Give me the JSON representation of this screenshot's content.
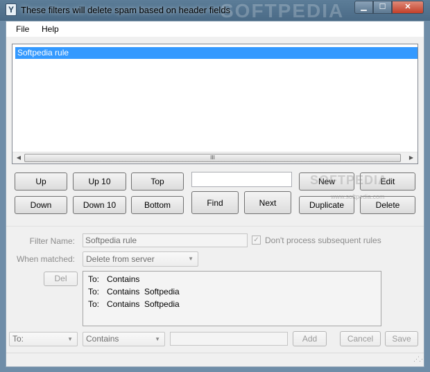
{
  "window": {
    "title": "These filters will delete spam based on header fields",
    "watermark": "SOFTPEDIA",
    "app_icon_glyph": "Y",
    "controls": {
      "minimize": "▁",
      "maximize": "☐",
      "close": "✕"
    }
  },
  "menu": {
    "file": "File",
    "help": "Help"
  },
  "rules": {
    "items": [
      "Softpedia rule"
    ],
    "selected_index": 0
  },
  "scrollbar": {
    "left_arrow": "◀",
    "right_arrow": "▶",
    "thumb_grip": "III"
  },
  "buttons": {
    "up": "Up",
    "up10": "Up 10",
    "top": "Top",
    "down": "Down",
    "down10": "Down 10",
    "bottom": "Bottom",
    "find": "Find",
    "next": "Next",
    "new": "New",
    "edit": "Edit",
    "duplicate": "Duplicate",
    "delete": "Delete",
    "del": "Del",
    "add": "Add",
    "cancel": "Cancel",
    "save": "Save"
  },
  "find_value": "",
  "button_watermark": {
    "text": "SOFTPEDIA",
    "url": "www.softpedia.com"
  },
  "editor": {
    "filter_name_label": "Filter Name:",
    "filter_name_value": "Softpedia rule",
    "dont_process_label": "Don't process subsequent rules",
    "dont_process_checked": true,
    "when_matched_label": "When matched:",
    "when_matched_value": "Delete from server",
    "conditions": [
      {
        "field": "To:",
        "op": "Contains",
        "value": ""
      },
      {
        "field": "To:",
        "op": "Contains",
        "value": "Softpedia"
      },
      {
        "field": "To:",
        "op": "Contains",
        "value": "Softpedia"
      }
    ],
    "new_field_value": "To:",
    "new_op_value": "Contains",
    "new_text_value": ""
  },
  "colors": {
    "selection": "#3399ff",
    "titlebar": "#4a6a86",
    "close": "#c2402a"
  }
}
